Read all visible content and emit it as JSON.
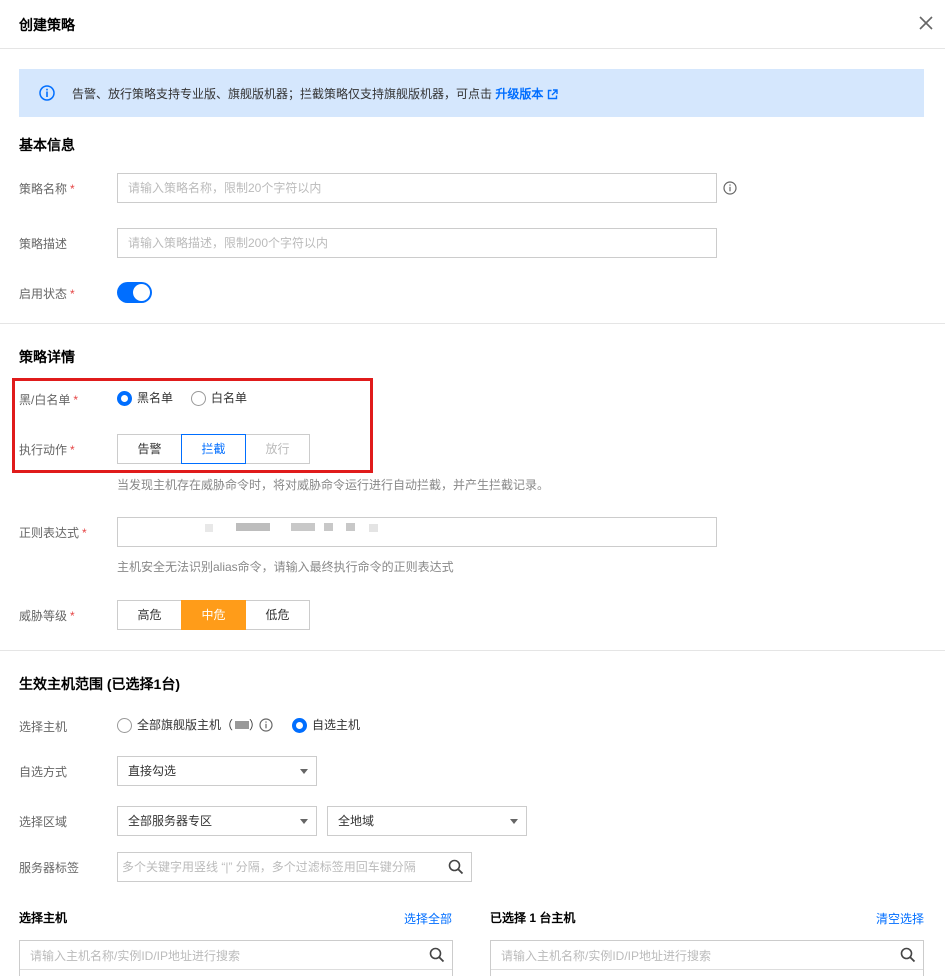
{
  "dialog": {
    "title": "创建策略"
  },
  "notice": {
    "text": "告警、放行策略支持专业版、旗舰版机器；拦截策略仅支持旗舰版机器，可点击 ",
    "link": "升级版本"
  },
  "basic": {
    "title": "基本信息",
    "name_label": "策略名称",
    "name_placeholder": "请输入策略名称，限制20个字符以内",
    "desc_label": "策略描述",
    "desc_placeholder": "请输入策略描述，限制200个字符以内",
    "status_label": "启用状态",
    "status_on": true
  },
  "detail": {
    "title": "策略详情",
    "list_label": "黑/白名单",
    "list_options": [
      "黑名单",
      "白名单"
    ],
    "list_selected": "黑名单",
    "action_label": "执行动作",
    "action_options": [
      "告警",
      "拦截",
      "放行"
    ],
    "action_selected": "拦截",
    "action_hint": "当发现主机存在威胁命令时，将对威胁命令运行进行自动拦截，并产生拦截记录。",
    "regex_label": "正则表达式",
    "regex_hint": "主机安全无法识别alias命令，请输入最终执行命令的正则表达式",
    "threat_label": "威胁等级",
    "threat_options": [
      "高危",
      "中危",
      "低危"
    ],
    "threat_selected": "中危"
  },
  "scope": {
    "title": "生效主机范围 (已选择1台)",
    "host_label": "选择主机",
    "host_options": [
      "全部旗舰版主机（",
      "自选主机"
    ],
    "host_selected": "自选主机",
    "mode_label": "自选方式",
    "mode_value": "直接勾选",
    "region_label": "选择区域",
    "zone_value": "全部服务器专区",
    "region_value": "全地域",
    "tag_label": "服务器标签",
    "tag_placeholder": "多个关键字用竖线 “|” 分隔，多个过滤标签用回车键分隔"
  },
  "picker": {
    "left_title": "选择主机",
    "select_all": "选择全部",
    "left_placeholder": "请输入主机名称/实例ID/IP地址进行搜索",
    "right_title": "已选择 1 台主机",
    "clear": "清空选择",
    "right_placeholder": "请输入主机名称/实例ID/IP地址进行搜索"
  },
  "colors": {
    "primary": "#006eff",
    "warning": "#ff9c19",
    "required": "#e54545",
    "notice_bg": "#d5e7fd"
  }
}
